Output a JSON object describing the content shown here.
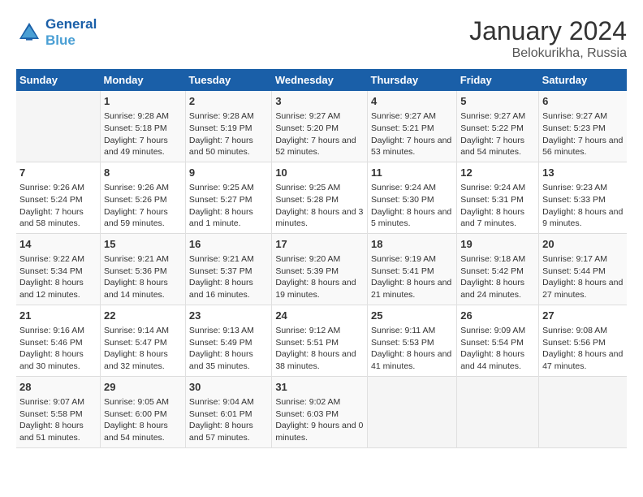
{
  "header": {
    "logo_line1": "General",
    "logo_line2": "Blue",
    "title": "January 2024",
    "subtitle": "Belokurikha, Russia"
  },
  "columns": [
    "Sunday",
    "Monday",
    "Tuesday",
    "Wednesday",
    "Thursday",
    "Friday",
    "Saturday"
  ],
  "weeks": [
    [
      {
        "day": "",
        "empty": true
      },
      {
        "day": "1",
        "sunrise": "9:28 AM",
        "sunset": "5:18 PM",
        "daylight": "7 hours and 49 minutes."
      },
      {
        "day": "2",
        "sunrise": "9:28 AM",
        "sunset": "5:19 PM",
        "daylight": "7 hours and 50 minutes."
      },
      {
        "day": "3",
        "sunrise": "9:27 AM",
        "sunset": "5:20 PM",
        "daylight": "7 hours and 52 minutes."
      },
      {
        "day": "4",
        "sunrise": "9:27 AM",
        "sunset": "5:21 PM",
        "daylight": "7 hours and 53 minutes."
      },
      {
        "day": "5",
        "sunrise": "9:27 AM",
        "sunset": "5:22 PM",
        "daylight": "7 hours and 54 minutes."
      },
      {
        "day": "6",
        "sunrise": "9:27 AM",
        "sunset": "5:23 PM",
        "daylight": "7 hours and 56 minutes."
      }
    ],
    [
      {
        "day": "7",
        "sunrise": "9:26 AM",
        "sunset": "5:24 PM",
        "daylight": "7 hours and 58 minutes."
      },
      {
        "day": "8",
        "sunrise": "9:26 AM",
        "sunset": "5:26 PM",
        "daylight": "7 hours and 59 minutes."
      },
      {
        "day": "9",
        "sunrise": "9:25 AM",
        "sunset": "5:27 PM",
        "daylight": "8 hours and 1 minute."
      },
      {
        "day": "10",
        "sunrise": "9:25 AM",
        "sunset": "5:28 PM",
        "daylight": "8 hours and 3 minutes."
      },
      {
        "day": "11",
        "sunrise": "9:24 AM",
        "sunset": "5:30 PM",
        "daylight": "8 hours and 5 minutes."
      },
      {
        "day": "12",
        "sunrise": "9:24 AM",
        "sunset": "5:31 PM",
        "daylight": "8 hours and 7 minutes."
      },
      {
        "day": "13",
        "sunrise": "9:23 AM",
        "sunset": "5:33 PM",
        "daylight": "8 hours and 9 minutes."
      }
    ],
    [
      {
        "day": "14",
        "sunrise": "9:22 AM",
        "sunset": "5:34 PM",
        "daylight": "8 hours and 12 minutes."
      },
      {
        "day": "15",
        "sunrise": "9:21 AM",
        "sunset": "5:36 PM",
        "daylight": "8 hours and 14 minutes."
      },
      {
        "day": "16",
        "sunrise": "9:21 AM",
        "sunset": "5:37 PM",
        "daylight": "8 hours and 16 minutes."
      },
      {
        "day": "17",
        "sunrise": "9:20 AM",
        "sunset": "5:39 PM",
        "daylight": "8 hours and 19 minutes."
      },
      {
        "day": "18",
        "sunrise": "9:19 AM",
        "sunset": "5:41 PM",
        "daylight": "8 hours and 21 minutes."
      },
      {
        "day": "19",
        "sunrise": "9:18 AM",
        "sunset": "5:42 PM",
        "daylight": "8 hours and 24 minutes."
      },
      {
        "day": "20",
        "sunrise": "9:17 AM",
        "sunset": "5:44 PM",
        "daylight": "8 hours and 27 minutes."
      }
    ],
    [
      {
        "day": "21",
        "sunrise": "9:16 AM",
        "sunset": "5:46 PM",
        "daylight": "8 hours and 30 minutes."
      },
      {
        "day": "22",
        "sunrise": "9:14 AM",
        "sunset": "5:47 PM",
        "daylight": "8 hours and 32 minutes."
      },
      {
        "day": "23",
        "sunrise": "9:13 AM",
        "sunset": "5:49 PM",
        "daylight": "8 hours and 35 minutes."
      },
      {
        "day": "24",
        "sunrise": "9:12 AM",
        "sunset": "5:51 PM",
        "daylight": "8 hours and 38 minutes."
      },
      {
        "day": "25",
        "sunrise": "9:11 AM",
        "sunset": "5:53 PM",
        "daylight": "8 hours and 41 minutes."
      },
      {
        "day": "26",
        "sunrise": "9:09 AM",
        "sunset": "5:54 PM",
        "daylight": "8 hours and 44 minutes."
      },
      {
        "day": "27",
        "sunrise": "9:08 AM",
        "sunset": "5:56 PM",
        "daylight": "8 hours and 47 minutes."
      }
    ],
    [
      {
        "day": "28",
        "sunrise": "9:07 AM",
        "sunset": "5:58 PM",
        "daylight": "8 hours and 51 minutes."
      },
      {
        "day": "29",
        "sunrise": "9:05 AM",
        "sunset": "6:00 PM",
        "daylight": "8 hours and 54 minutes."
      },
      {
        "day": "30",
        "sunrise": "9:04 AM",
        "sunset": "6:01 PM",
        "daylight": "8 hours and 57 minutes."
      },
      {
        "day": "31",
        "sunrise": "9:02 AM",
        "sunset": "6:03 PM",
        "daylight": "9 hours and 0 minutes."
      },
      {
        "day": "",
        "empty": true
      },
      {
        "day": "",
        "empty": true
      },
      {
        "day": "",
        "empty": true
      }
    ]
  ],
  "labels": {
    "sunrise": "Sunrise:",
    "sunset": "Sunset:",
    "daylight": "Daylight:"
  }
}
